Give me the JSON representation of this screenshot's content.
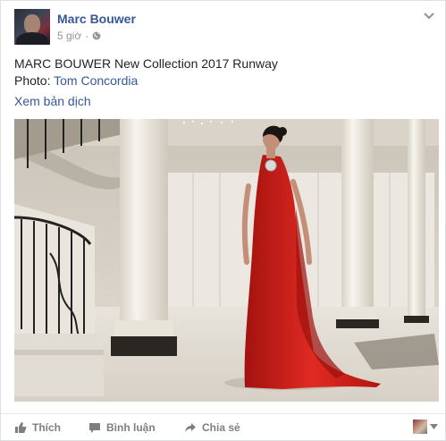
{
  "post": {
    "author": "Marc Bouwer",
    "timestamp": "5 giờ",
    "separator": "·",
    "audience_icon": "globe-icon",
    "body_line1": "MARC BOUWER New Collection 2017 Runway",
    "photo_credit_prefix": "Photo: ",
    "photo_credit_name": "Tom Concordia",
    "translate_link": "Xem bản dịch",
    "photo_alt": "Model in red gown on runway"
  },
  "actions": {
    "like_label": "Thích",
    "comment_label": "Bình luận",
    "share_label": "Chia sẻ"
  },
  "colors": {
    "link_blue": "#365899",
    "gray_text": "#90949c",
    "action_gray": "#7f7f7f",
    "dress_red": "#d0201c"
  }
}
